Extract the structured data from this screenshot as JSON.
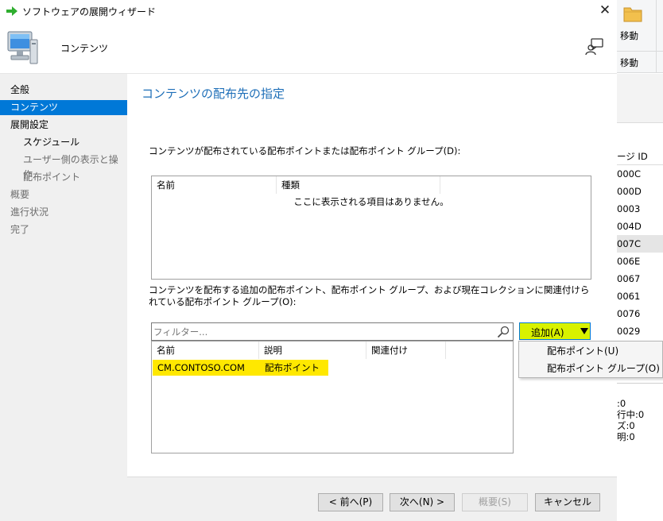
{
  "window": {
    "title": "ソフトウェアの展開ウィザード",
    "close_glyph": "✕",
    "header_title": "コンテンツ"
  },
  "nav": {
    "items": [
      {
        "label": "全般"
      },
      {
        "label": "コンテンツ",
        "active": true
      },
      {
        "label": "展開設定"
      },
      {
        "label": "スケジュール"
      },
      {
        "label": "ユーザー側の表示と操作"
      },
      {
        "label": "配布ポイント"
      },
      {
        "label": "概要"
      },
      {
        "label": "進行状況"
      },
      {
        "label": "完了"
      }
    ]
  },
  "main": {
    "page_title": "コンテンツの配布先の指定",
    "label_distributed": "コンテンツが配布されている配布ポイントまたは配布ポイント グループ(D):",
    "list1": {
      "columns": [
        "名前",
        "種類"
      ],
      "empty_text": "ここに表示される項目はありません。"
    },
    "label_additional": "コンテンツを配布する追加の配布ポイント、配布ポイント グループ、および現在コレクションに関連付けられている配布ポイント グループ(O):",
    "filter_placeholder": "フィルター...",
    "list2": {
      "columns": [
        "名前",
        "説明",
        "関連付け"
      ],
      "rows": [
        {
          "name": "CM.CONTOSO.COM",
          "description": "配布ポイント",
          "association": ""
        }
      ]
    },
    "add_button": {
      "label": "追加(A)",
      "menu": [
        "配布ポイント(U)",
        "配布ポイント グループ(O)"
      ]
    }
  },
  "footer": {
    "prev": "< 前へ(P)",
    "next": "次へ(N) >",
    "summary": "概要(S)",
    "cancel": "キャンセル"
  },
  "console": {
    "ribbon_move_1": "移動",
    "ribbon_move_2": "移動",
    "column_header": "ージ ID",
    "rows": [
      "000C",
      "000D",
      "0003",
      "004D",
      "007C",
      "006E",
      "0067",
      "0061",
      "0076",
      "0029"
    ],
    "selected_row": "007C",
    "status_lines": [
      ":0",
      "行中:0",
      "ズ:0",
      "明:0"
    ]
  }
}
